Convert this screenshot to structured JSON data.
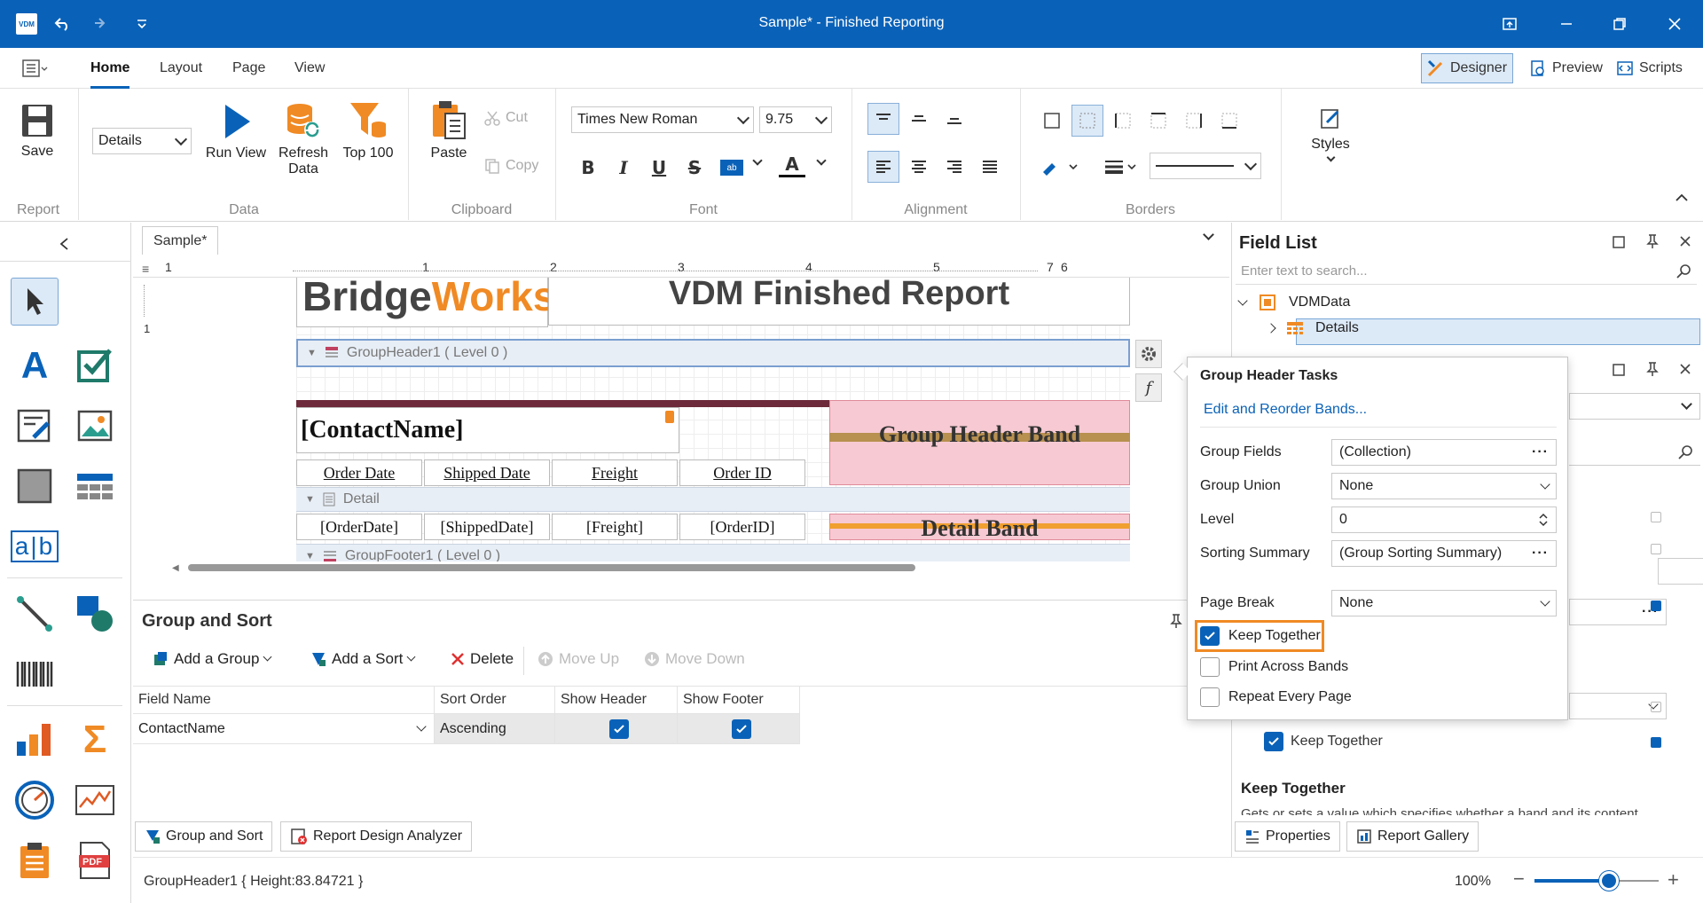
{
  "window": {
    "title": "Sample* - Finished Reporting",
    "app_badge": "VDM"
  },
  "menu": {
    "tabs": [
      "Home",
      "Layout",
      "Page",
      "View"
    ],
    "modes": [
      "Designer",
      "Preview",
      "Scripts"
    ]
  },
  "ribbon": {
    "save": "Save",
    "group_report": "Report",
    "data_source": "Details",
    "run_view": "Run View",
    "refresh_data": "Refresh Data",
    "top100": "Top 100",
    "group_data": "Data",
    "paste": "Paste",
    "cut": "Cut",
    "copy": "Copy",
    "group_clipboard": "Clipboard",
    "font_name": "Times New Roman",
    "font_size": "9.75",
    "group_font": "Font",
    "group_alignment": "Alignment",
    "group_borders": "Borders",
    "styles": "Styles"
  },
  "document": {
    "tab": "Sample*",
    "ruler": [
      "1",
      "1",
      "2",
      "3",
      "4",
      "5",
      "6",
      "7"
    ],
    "logo_a": "Bridge",
    "logo_b": "Works",
    "report_title": "VDM Finished Report",
    "group_header_band": "GroupHeader1 ( Level 0 )",
    "contact": "[ContactName]",
    "group_header_label": "Group Header Band",
    "headers": [
      "Order Date",
      "Shipped Date",
      "Freight",
      "Order ID"
    ],
    "detail_band": "Detail",
    "detail_fields": [
      "[OrderDate]",
      "[ShippedDate]",
      "[Freight]",
      "[OrderID]"
    ],
    "detail_label": "Detail Band",
    "group_footer_band": "GroupFooter1 ( Level 0 )"
  },
  "group_sort": {
    "title": "Group and Sort",
    "toolbar": {
      "add_group": "Add a Group",
      "add_sort": "Add a Sort",
      "delete": "Delete",
      "move_up": "Move Up",
      "move_down": "Move Down"
    },
    "columns": [
      "Field Name",
      "Sort Order",
      "Show Header",
      "Show Footer"
    ],
    "rows": [
      {
        "field": "ContactName",
        "order": "Ascending",
        "show_header": true,
        "show_footer": true
      }
    ]
  },
  "bottom_tabs": [
    "Group and Sort",
    "Report Design Analyzer"
  ],
  "status": {
    "selection": "GroupHeader1 { Height:83.84721 }",
    "zoom": "100%",
    "zoom_level": 0.6
  },
  "field_list": {
    "title": "Field List",
    "search_placeholder": "Enter text to search...",
    "root": "VDMData",
    "child": "Details"
  },
  "properties_partial": {
    "keep_together": "Keep Together",
    "desc_title": "Keep Together",
    "desc_text": "Gets or sets a value which specifies whether a band and its content"
  },
  "right_tabs": [
    "Properties",
    "Report Gallery"
  ],
  "tasks": {
    "title": "Group Header Tasks",
    "link": "Edit and Reorder Bands...",
    "group_fields_label": "Group Fields",
    "group_fields": "(Collection)",
    "group_union_label": "Group Union",
    "group_union": "None",
    "level_label": "Level",
    "level": "0",
    "sorting_summary_label": "Sorting Summary",
    "sorting_summary": "(Group Sorting Summary)",
    "page_break_label": "Page Break",
    "page_break": "None",
    "keep_together": "Keep Together",
    "print_across": "Print Across Bands",
    "repeat_every": "Repeat Every Page"
  },
  "colors": {
    "accent": "#0a62b8",
    "highlight": "#f08a24",
    "band_pink": "#f7c9d2",
    "band_brown": "#6d2a3a"
  }
}
